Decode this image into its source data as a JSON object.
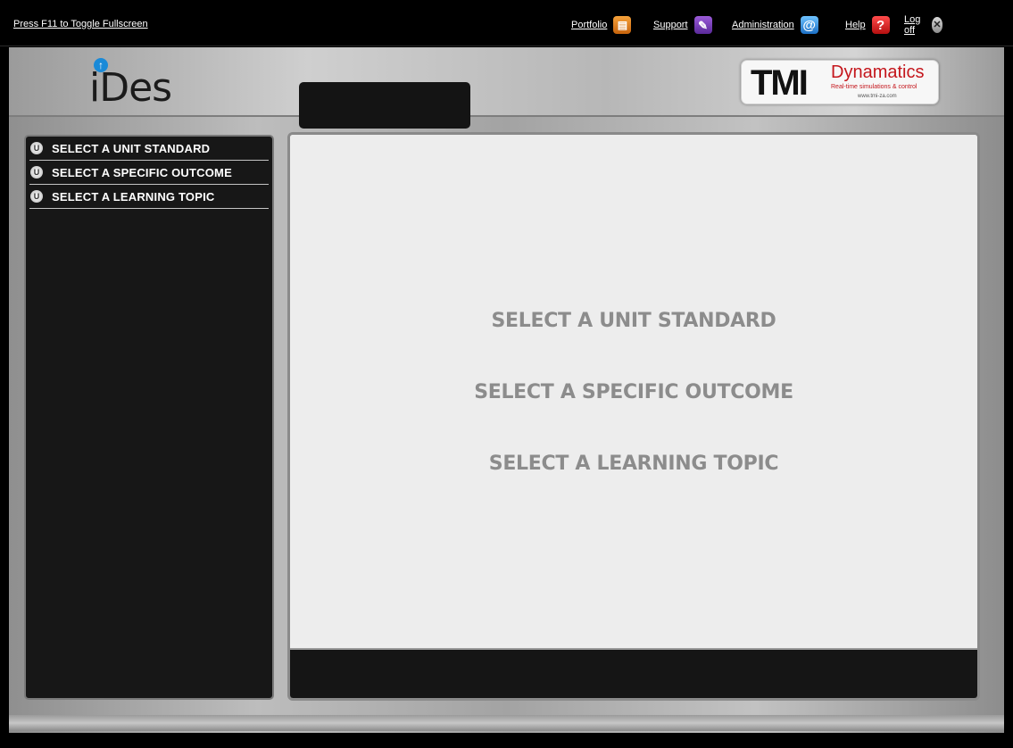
{
  "topbar": {
    "fullscreen_hint": "Press F11 to Toggle Fullscreen",
    "nav": [
      {
        "label": "Portfolio",
        "icon": "portfolio-icon",
        "glyph": "▤"
      },
      {
        "label": "Support",
        "icon": "wrench-icon",
        "glyph": "✎"
      },
      {
        "label": "Administration",
        "icon": "at-sign-icon",
        "glyph": "@"
      },
      {
        "label": "Help",
        "icon": "help-icon",
        "glyph": "?"
      },
      {
        "label": "Log off",
        "icon": "logoff-icon",
        "glyph": "✕"
      }
    ]
  },
  "header": {
    "app_logo_text": "iDes",
    "company_logo": {
      "mark": "TMI",
      "name": "Dynamatics",
      "tagline": "Real-time simulations & control",
      "url": "www.tmi-za.com"
    }
  },
  "sidebar": {
    "items": [
      {
        "label": "SELECT A UNIT STANDARD"
      },
      {
        "label": "SELECT A SPECIFIC OUTCOME"
      },
      {
        "label": "SELECT A LEARNING TOPIC"
      }
    ]
  },
  "main": {
    "prompts": [
      "SELECT A UNIT STANDARD",
      "SELECT A SPECIFIC OUTCOME",
      "SELECT A LEARNING TOPIC"
    ]
  },
  "colors": {
    "accent_blue": "#1a8ad8",
    "brand_red": "#c4161c",
    "panel_dark": "#171717",
    "prompt_gray": "#8c8c8c"
  }
}
